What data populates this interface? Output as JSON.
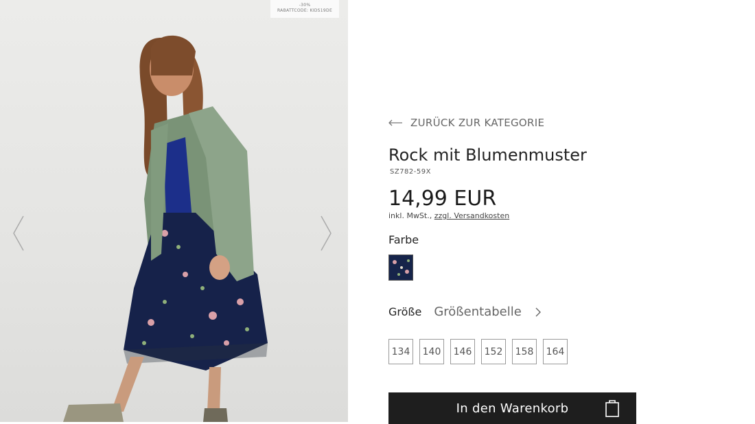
{
  "promo": {
    "line1": "-30%",
    "line2": "RABATTCODE: KIDS19DE"
  },
  "gallery": {
    "prev_icon": "chevron-left-icon",
    "next_icon": "chevron-right-icon"
  },
  "nav": {
    "back_label": "ZURÜCK ZUR KATEGORIE"
  },
  "product": {
    "title": "Rock mit Blumenmuster",
    "sku": "SZ782-59X",
    "price": "14,99 EUR",
    "tax_prefix": "inkl. MwSt.,",
    "shipping_link": "zzgl. Versandkosten"
  },
  "color": {
    "label": "Farbe"
  },
  "size": {
    "label": "Größe",
    "chart_link": "Größentabelle",
    "options": [
      "134",
      "140",
      "146",
      "152",
      "158",
      "164"
    ]
  },
  "cart": {
    "label": "In den Warenkorb",
    "icon": "shopping-bag-icon"
  },
  "colors": {
    "button_bg": "#1e1e1e",
    "swatch": "#16244a"
  }
}
